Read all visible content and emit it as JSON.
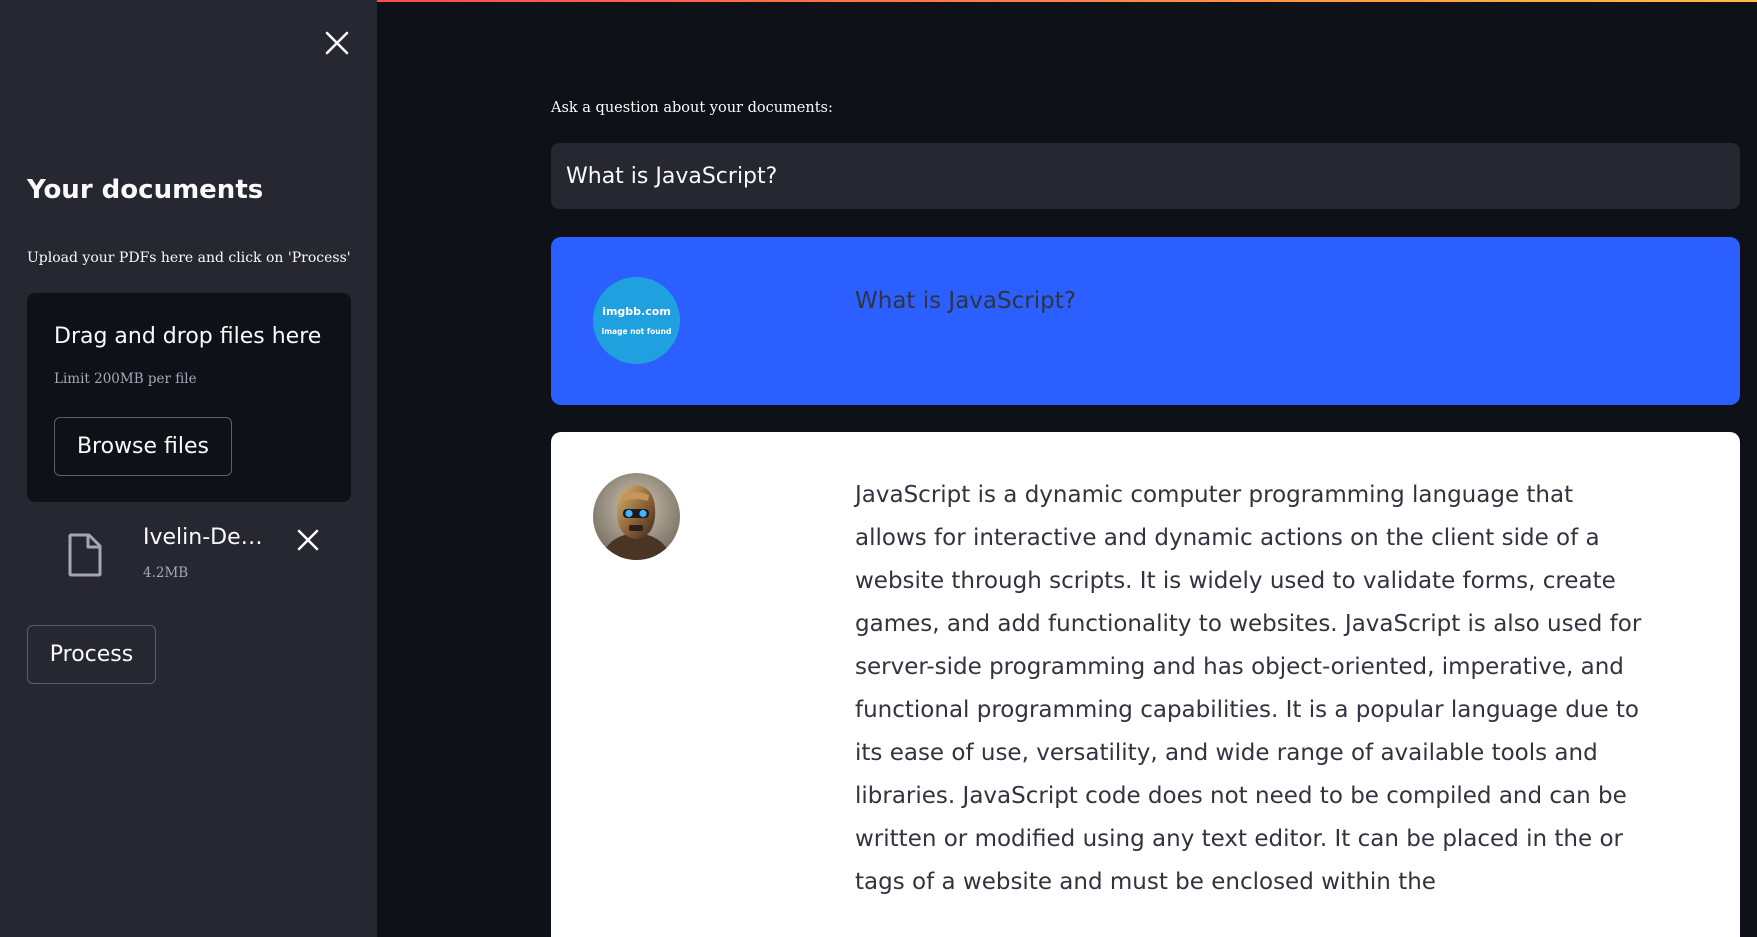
{
  "sidebar": {
    "title": "Your documents",
    "instruction": "Upload your PDFs here and click on 'Process'",
    "uploader": {
      "drop_label": "Drag and drop files here",
      "limit_text": "Limit 200MB per file",
      "browse_label": "Browse files"
    },
    "file": {
      "name": "Ivelin-De…",
      "size": "4.2MB"
    },
    "process_label": "Process"
  },
  "main": {
    "question_label": "Ask a question about your documents:",
    "question_value": "What is JavaScript?",
    "messages": [
      {
        "role": "user",
        "avatar_text": [
          "imgbb.com",
          "image not found"
        ],
        "text": "What is JavaScript?"
      },
      {
        "role": "bot",
        "text": "JavaScript is a dynamic computer programming language that allows for interactive and dynamic actions on the client side of a website through scripts. It is widely used to validate forms, create games, and add functionality to websites. JavaScript is also used for server-side programming and has object-oriented, imperative, and functional programming capabilities. It is a popular language due to its ease of use, versatility, and wide range of available tools and libraries. JavaScript code does not need to be compiled and can be written or modified using any text editor. It can be placed in the or tags of a website and must be enclosed within the"
      }
    ]
  },
  "colors": {
    "background": "#0e1117",
    "sidebar": "#262730",
    "user_message": "#2b5fff",
    "bot_message": "#ffffff",
    "user_avatar": "#1fa1e0"
  }
}
